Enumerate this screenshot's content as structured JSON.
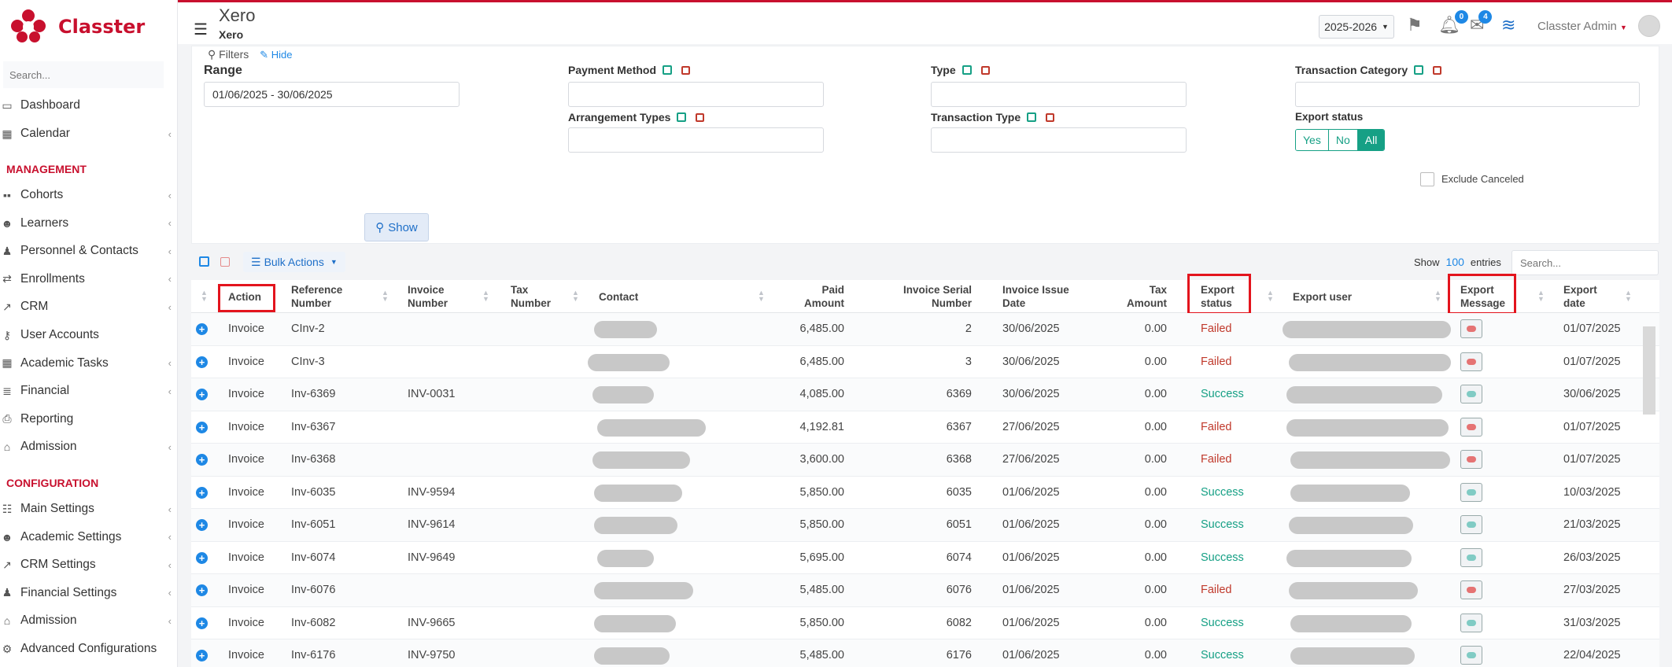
{
  "brand": {
    "name": "Classter",
    "color": "#c8102e"
  },
  "sidebar": {
    "search_placeholder": "Search...",
    "items": [
      {
        "label": "Dashboard",
        "icon": "laptop-icon",
        "chevron": false
      },
      {
        "label": "Calendar",
        "icon": "calendar-icon",
        "chevron": true
      }
    ],
    "management_title": "MANAGEMENT",
    "management_items": [
      {
        "label": "Cohorts",
        "icon": "cohorts-icon",
        "chevron": true
      },
      {
        "label": "Learners",
        "icon": "learners-icon",
        "chevron": true
      },
      {
        "label": "Personnel & Contacts",
        "icon": "person-icon",
        "chevron": true
      },
      {
        "label": "Enrollments",
        "icon": "arrows-icon",
        "chevron": true
      },
      {
        "label": "CRM",
        "icon": "crm-icon",
        "chevron": true
      },
      {
        "label": "User Accounts",
        "icon": "key-icon",
        "chevron": false
      },
      {
        "label": "Academic Tasks",
        "icon": "grid-icon",
        "chevron": true
      },
      {
        "label": "Financial",
        "icon": "stack-icon",
        "chevron": true
      },
      {
        "label": "Reporting",
        "icon": "printer-icon",
        "chevron": false
      },
      {
        "label": "Admission",
        "icon": "bank-icon",
        "chevron": true
      }
    ],
    "configuration_title": "CONFIGURATION",
    "configuration_items": [
      {
        "label": "Main Settings",
        "icon": "sliders-icon",
        "chevron": true
      },
      {
        "label": "Academic Settings",
        "icon": "learners-icon",
        "chevron": true
      },
      {
        "label": "CRM Settings",
        "icon": "crm-icon",
        "chevron": true
      },
      {
        "label": "Financial Settings",
        "icon": "person-icon",
        "chevron": true
      },
      {
        "label": "Admission",
        "icon": "bank-icon",
        "chevron": true
      },
      {
        "label": "Advanced Configurations",
        "icon": "gears-icon",
        "chevron": false
      }
    ]
  },
  "topbar": {
    "title": "Xero",
    "subtitle": "Xero",
    "year": "2025-2026",
    "notifications_count": "0",
    "messages_count": "4",
    "user_name": "Classter Admin"
  },
  "filters": {
    "toggle_label": "Filters",
    "hide_label": "Hide",
    "range_label": "Range",
    "range_value": "01/06/2025 - 30/06/2025",
    "payment_method_label": "Payment Method",
    "type_label": "Type",
    "transaction_category_label": "Transaction Category",
    "arrangement_types_label": "Arrangement Types",
    "transaction_type_label": "Transaction Type",
    "export_status_label": "Export status",
    "export_status_options": [
      "Yes",
      "No",
      "All"
    ],
    "export_status_selected": "All",
    "exclude_canceled_label": "Exclude Canceled",
    "show_button": "Show"
  },
  "table_toolbar": {
    "bulk_actions": "Bulk Actions",
    "show_label": "Show",
    "entries_count": "100",
    "entries_label": "entries",
    "search_placeholder": "Search..."
  },
  "columns": {
    "action": "Action",
    "reference": "Reference Number",
    "invoice_number": "Invoice Number",
    "tax_number": "Tax Number",
    "contact": "Contact",
    "paid_amount": "Paid Amount",
    "invoice_serial": "Invoice Serial Number",
    "invoice_issue_date": "Invoice Issue Date",
    "tax_amount": "Tax Amount",
    "export_status": "Export status",
    "export_user": "Export user",
    "export_message": "Export Message",
    "export_date": "Export date"
  },
  "colors": {
    "failed": "#c0392b",
    "success": "#16a085",
    "accent": "#1e88e5",
    "highlight": "#e3141d"
  },
  "rows": [
    {
      "action": "Invoice",
      "reference": "CInv-2",
      "invoice_number": "",
      "paid_amount": "6,485.00",
      "serial": "2",
      "issue_date": "30/06/2025",
      "tax_amount": "0.00",
      "status": "Failed",
      "export_date": "01/07/2025"
    },
    {
      "action": "Invoice",
      "reference": "CInv-3",
      "invoice_number": "",
      "paid_amount": "6,485.00",
      "serial": "3",
      "issue_date": "30/06/2025",
      "tax_amount": "0.00",
      "status": "Failed",
      "export_date": "01/07/2025"
    },
    {
      "action": "Invoice",
      "reference": "Inv-6369",
      "invoice_number": "INV-0031",
      "paid_amount": "4,085.00",
      "serial": "6369",
      "issue_date": "30/06/2025",
      "tax_amount": "0.00",
      "status": "Success",
      "export_date": "30/06/2025"
    },
    {
      "action": "Invoice",
      "reference": "Inv-6367",
      "invoice_number": "",
      "paid_amount": "4,192.81",
      "serial": "6367",
      "issue_date": "27/06/2025",
      "tax_amount": "0.00",
      "status": "Failed",
      "export_date": "01/07/2025"
    },
    {
      "action": "Invoice",
      "reference": "Inv-6368",
      "invoice_number": "",
      "paid_amount": "3,600.00",
      "serial": "6368",
      "issue_date": "27/06/2025",
      "tax_amount": "0.00",
      "status": "Failed",
      "export_date": "01/07/2025"
    },
    {
      "action": "Invoice",
      "reference": "Inv-6035",
      "invoice_number": "INV-9594",
      "paid_amount": "5,850.00",
      "serial": "6035",
      "issue_date": "01/06/2025",
      "tax_amount": "0.00",
      "status": "Success",
      "export_date": "10/03/2025"
    },
    {
      "action": "Invoice",
      "reference": "Inv-6051",
      "invoice_number": "INV-9614",
      "paid_amount": "5,850.00",
      "serial": "6051",
      "issue_date": "01/06/2025",
      "tax_amount": "0.00",
      "status": "Success",
      "export_date": "21/03/2025"
    },
    {
      "action": "Invoice",
      "reference": "Inv-6074",
      "invoice_number": "INV-9649",
      "paid_amount": "5,695.00",
      "serial": "6074",
      "issue_date": "01/06/2025",
      "tax_amount": "0.00",
      "status": "Success",
      "export_date": "26/03/2025"
    },
    {
      "action": "Invoice",
      "reference": "Inv-6076",
      "invoice_number": "",
      "paid_amount": "5,485.00",
      "serial": "6076",
      "issue_date": "01/06/2025",
      "tax_amount": "0.00",
      "status": "Failed",
      "export_date": "27/03/2025"
    },
    {
      "action": "Invoice",
      "reference": "Inv-6082",
      "invoice_number": "INV-9665",
      "paid_amount": "5,850.00",
      "serial": "6082",
      "issue_date": "01/06/2025",
      "tax_amount": "0.00",
      "status": "Success",
      "export_date": "31/03/2025"
    },
    {
      "action": "Invoice",
      "reference": "Inv-6176",
      "invoice_number": "INV-9750",
      "paid_amount": "5,485.00",
      "serial": "6176",
      "issue_date": "01/06/2025",
      "tax_amount": "0.00",
      "status": "Success",
      "export_date": "22/04/2025"
    }
  ]
}
